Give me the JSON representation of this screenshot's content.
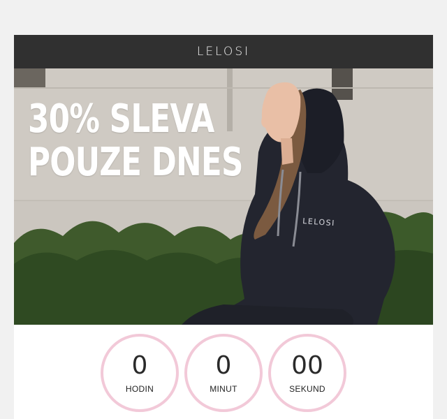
{
  "brand": {
    "logo_text": "LELOSI"
  },
  "hero": {
    "headline_line1": "30% SLEVA",
    "headline_line2": "POUZE DNES",
    "sweatshirt_print": "LELOSI"
  },
  "countdown": {
    "hours": {
      "value": "0",
      "label": "HODIN"
    },
    "minutes": {
      "value": "0",
      "label": "MINUT"
    },
    "seconds": {
      "value": "00",
      "label": "SEKUND"
    }
  },
  "colors": {
    "header_bg": "#303030",
    "page_bg": "#f1f1f1",
    "ring": "#f2c9d8",
    "hoodie": "#23252f"
  }
}
